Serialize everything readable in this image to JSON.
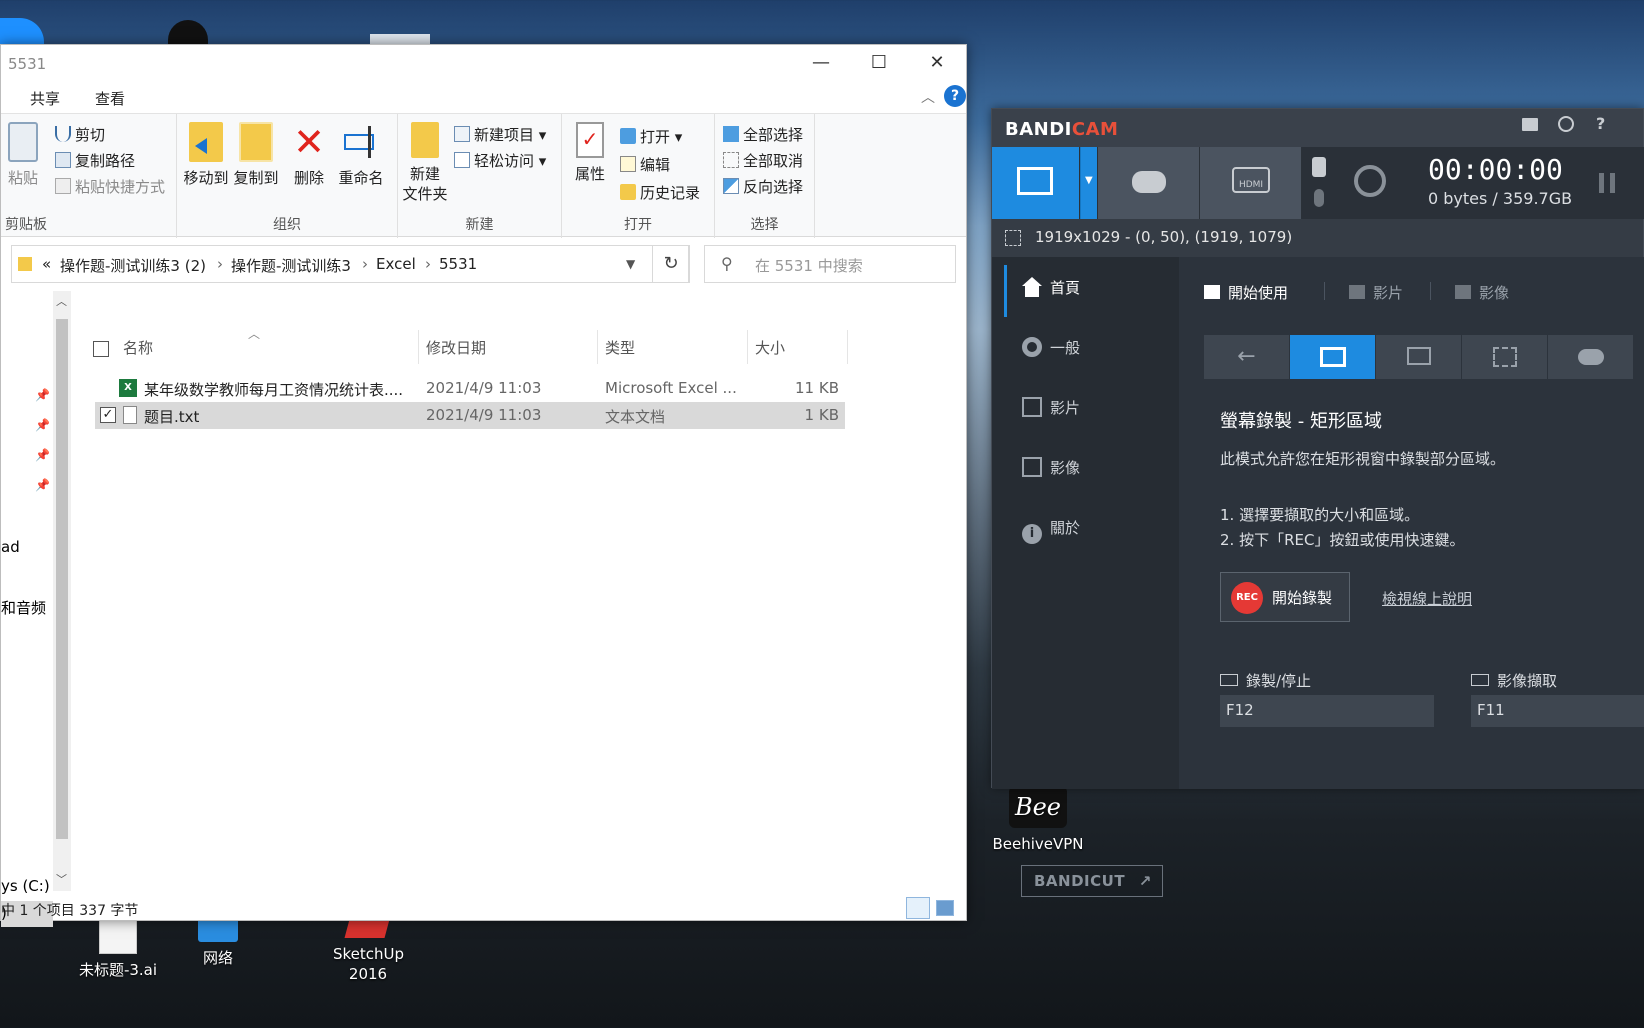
{
  "desktop": {
    "icons": [
      {
        "label": "未标题-3.ai"
      },
      {
        "label": "网络"
      },
      {
        "label": "SketchUp 2016"
      },
      {
        "label": "BeehiveVPN"
      }
    ]
  },
  "explorer": {
    "title": "5531",
    "ribbon_tabs": [
      "共享",
      "查看"
    ],
    "clipboard": {
      "paste": "粘贴",
      "cut": "剪切",
      "copy_path": "复制路径",
      "paste_shortcut": "粘贴快捷方式",
      "group": "剪贴板"
    },
    "organize": {
      "move_to": "移动到",
      "copy_to": "复制到",
      "delete": "删除",
      "rename": "重命名",
      "group": "组织"
    },
    "new": {
      "new_folder_1": "新建",
      "new_folder_2": "文件夹",
      "new_item": "新建项目",
      "easy_access": "轻松访问",
      "group": "新建"
    },
    "open": {
      "properties": "属性",
      "open": "打开",
      "edit": "编辑",
      "history": "历史记录",
      "group": "打开"
    },
    "select": {
      "select_all": "全部选择",
      "select_none": "全部取消",
      "invert": "反向选择",
      "group": "选择"
    },
    "breadcrumb": {
      "overflow": "«",
      "parts": [
        "操作题-测试训练3 (2)",
        "操作题-测试训练3",
        "Excel",
        "5531"
      ]
    },
    "search_placeholder": "在 5531 中搜索",
    "nav_fragments": [
      "ad",
      "和音频",
      "ys (C:)",
      ")"
    ],
    "columns": [
      "名称",
      "修改日期",
      "类型",
      "大小"
    ],
    "files": [
      {
        "name": "某年级数学教师每月工资情况统计表....",
        "modified": "2021/4/9 11:03",
        "type": "Microsoft Excel ...",
        "size": "11 KB"
      },
      {
        "name": "题目.txt",
        "modified": "2021/4/9 11:03",
        "type": "文本文档",
        "size": "1 KB"
      }
    ],
    "status": "中 1 个项目  337 字节"
  },
  "bandicam": {
    "logo_a": "BANDI",
    "logo_b": "CAM",
    "timer": "00:00:00",
    "storage": "0 bytes / 359.7GB",
    "dimensions": "1919x1029 - (0, 50), (1919, 1079)",
    "sidebar": [
      "首頁",
      "一般",
      "影片",
      "影像",
      "關於"
    ],
    "subtabs": [
      "開始使用",
      "影片",
      "影像"
    ],
    "heading": "螢幕錄製 - 矩形區域",
    "desc": "此模式允許您在矩形視窗中錄製部分區域。",
    "step1": "1. 選擇要擷取的大小和區域。",
    "step2": "2. 按下「REC」按鈕或使用快速鍵。",
    "rec_badge": "REC",
    "rec_label": "開始錄製",
    "help_link": "檢視線上說明",
    "hotkey_record_label": "錄製/停止",
    "hotkey_record_value": "F12",
    "hotkey_image_label": "影像擷取",
    "hotkey_image_value": "F11",
    "hdmi": "HDMI",
    "bandicut_a": "BANDI",
    "bandicut_b": "CUT",
    "accent": "#1e8be0",
    "logo_accent": "#e8503a"
  }
}
